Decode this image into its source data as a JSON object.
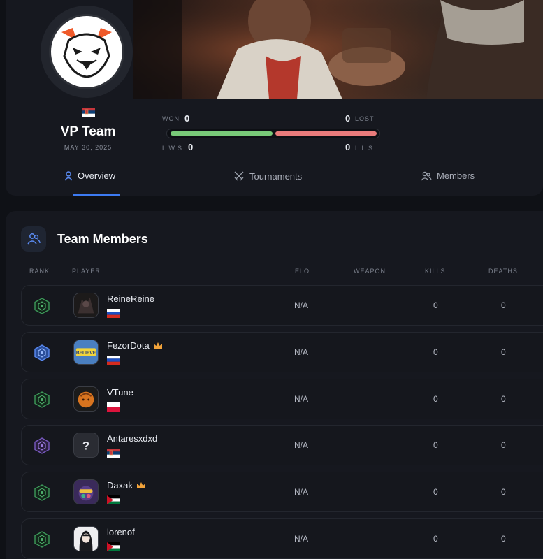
{
  "team": {
    "name": "VP Team",
    "date": "MAY 30, 2025",
    "flag": "serbia-flag"
  },
  "stats": {
    "won_label": "WON",
    "won": "0",
    "lost_label": "LOST",
    "lost": "0",
    "lws_label": "L.W.S",
    "lws": "0",
    "lls_label": "L.L.S",
    "lls": "0",
    "win_color": "#78c978",
    "loss_color": "#e97b7b"
  },
  "tabs": [
    {
      "label": "Overview",
      "icon": "user-icon",
      "active": true
    },
    {
      "label": "Tournaments",
      "icon": "crossed-swords-icon",
      "active": false
    },
    {
      "label": "Members",
      "icon": "users-icon",
      "active": false
    }
  ],
  "members": {
    "title": "Team Members",
    "columns": {
      "rank": "RANK",
      "player": "PLAYER",
      "elo": "ELO",
      "weapon": "WEAPON",
      "kills": "KILLS",
      "deaths": "DEATHS"
    },
    "rows": [
      {
        "name": "ReineReine",
        "flag": "russia-flag",
        "elo": "N/A",
        "kills": "0",
        "deaths": "0",
        "rank": "green",
        "crown": false
      },
      {
        "name": "FezorDota",
        "flag": "russia-flag",
        "elo": "N/A",
        "kills": "0",
        "deaths": "0",
        "rank": "blue",
        "crown": true
      },
      {
        "name": "VTune",
        "flag": "poland-flag",
        "elo": "N/A",
        "kills": "0",
        "deaths": "0",
        "rank": "green",
        "crown": false
      },
      {
        "name": "Antaresxdxd",
        "flag": "serbia-flag",
        "elo": "N/A",
        "kills": "0",
        "deaths": "0",
        "rank": "purple",
        "crown": false
      },
      {
        "name": "Daxak",
        "flag": "jordan-flag",
        "elo": "N/A",
        "kills": "0",
        "deaths": "0",
        "rank": "green",
        "crown": true
      },
      {
        "name": "lorenof",
        "flag": "jordan-flag",
        "elo": "N/A",
        "kills": "0",
        "deaths": "0",
        "rank": "green",
        "crown": false
      }
    ]
  },
  "accent": "#3d7bf2"
}
